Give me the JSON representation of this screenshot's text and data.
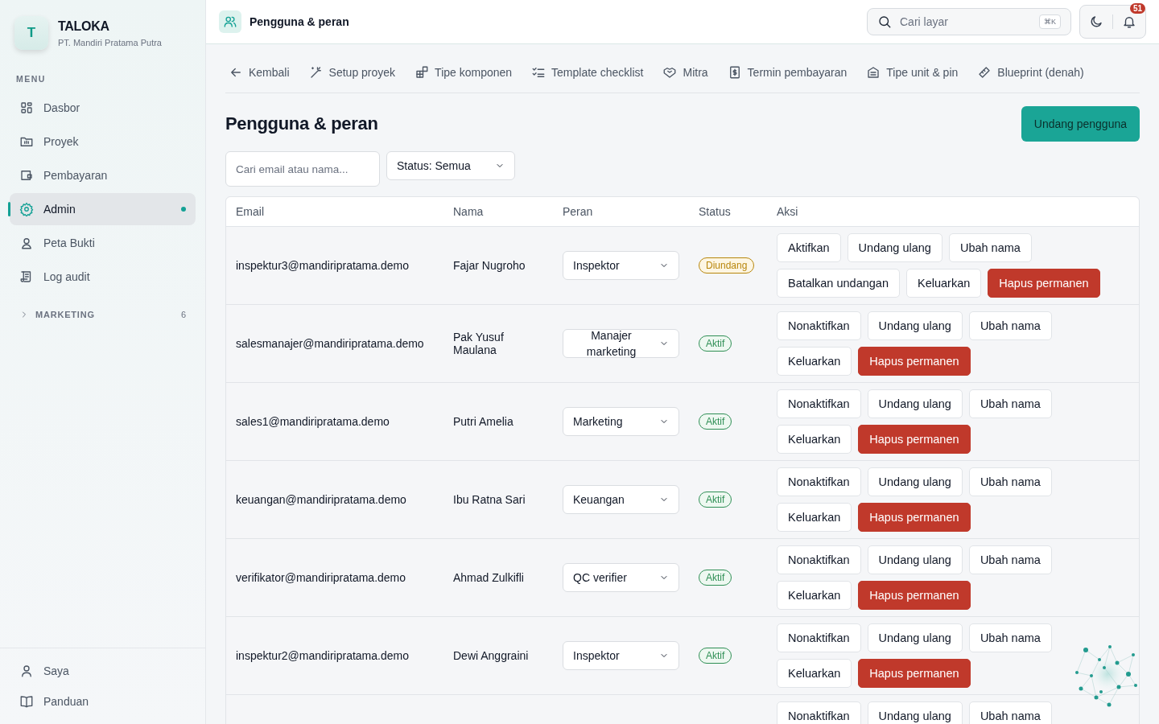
{
  "brand": {
    "logo_letter": "T",
    "name": "TALOKA",
    "company": "PT. Mandiri Pratama Putra"
  },
  "sidebar": {
    "section_label": "MENU",
    "items": [
      {
        "label": "Dasbor",
        "selected": false
      },
      {
        "label": "Proyek",
        "selected": false
      },
      {
        "label": "Pembayaran",
        "selected": false
      },
      {
        "label": "Admin",
        "selected": true
      },
      {
        "label": "Peta Bukti",
        "selected": false
      },
      {
        "label": "Log audit",
        "selected": false
      }
    ],
    "group": {
      "label": "MARKETING",
      "count": "6",
      "expanded": false
    },
    "footer_items": [
      {
        "label": "Saya"
      },
      {
        "label": "Panduan"
      }
    ]
  },
  "topbar": {
    "title": "Pengguna & peran",
    "search": {
      "placeholder": "Cari layar",
      "shortcut": "⌘K"
    },
    "notification_count": "51"
  },
  "subnav": [
    {
      "label": "Kembali"
    },
    {
      "label": "Setup proyek"
    },
    {
      "label": "Tipe komponen"
    },
    {
      "label": "Template checklist"
    },
    {
      "label": "Mitra"
    },
    {
      "label": "Termin pembayaran"
    },
    {
      "label": "Tipe unit & pin"
    },
    {
      "label": "Blueprint (denah)"
    }
  ],
  "page": {
    "title": "Pengguna & peran",
    "primary_button": "Undang pengguna"
  },
  "filters": {
    "search": {
      "placeholder": "Cari email atau nama..."
    },
    "status": {
      "value": "Status: Semua"
    }
  },
  "table": {
    "columns": [
      "Email",
      "Nama",
      "Peran",
      "Status",
      "Aksi"
    ],
    "rows": [
      {
        "email": "inspektur3@mandiripratama.demo",
        "name": "Fajar Nugroho",
        "role": "Inspektor",
        "status": {
          "label": "Diundang",
          "kind": "invited"
        },
        "actions": [
          {
            "label": "Aktifkan",
            "kind": "default"
          },
          {
            "label": "Undang ulang",
            "kind": "default"
          },
          {
            "label": "Ubah nama",
            "kind": "default"
          },
          {
            "label": "Batalkan undangan",
            "kind": "default"
          },
          {
            "label": "Keluarkan",
            "kind": "default"
          },
          {
            "label": "Hapus permanen",
            "kind": "danger"
          }
        ]
      },
      {
        "email": "salesmanajer@mandiripratama.demo",
        "name": "Pak Yusuf Maulana",
        "role": "Manajer marketing",
        "status": {
          "label": "Aktif",
          "kind": "active"
        },
        "actions": [
          {
            "label": "Nonaktifkan",
            "kind": "default"
          },
          {
            "label": "Undang ulang",
            "kind": "default"
          },
          {
            "label": "Ubah nama",
            "kind": "default"
          },
          {
            "label": "Keluarkan",
            "kind": "default"
          },
          {
            "label": "Hapus permanen",
            "kind": "danger"
          }
        ]
      },
      {
        "email": "sales1@mandiripratama.demo",
        "name": "Putri Amelia",
        "role": "Marketing",
        "status": {
          "label": "Aktif",
          "kind": "active"
        },
        "actions": [
          {
            "label": "Nonaktifkan",
            "kind": "default"
          },
          {
            "label": "Undang ulang",
            "kind": "default"
          },
          {
            "label": "Ubah nama",
            "kind": "default"
          },
          {
            "label": "Keluarkan",
            "kind": "default"
          },
          {
            "label": "Hapus permanen",
            "kind": "danger"
          }
        ]
      },
      {
        "email": "keuangan@mandiripratama.demo",
        "name": "Ibu Ratna Sari",
        "role": "Keuangan",
        "status": {
          "label": "Aktif",
          "kind": "active"
        },
        "actions": [
          {
            "label": "Nonaktifkan",
            "kind": "default"
          },
          {
            "label": "Undang ulang",
            "kind": "default"
          },
          {
            "label": "Ubah nama",
            "kind": "default"
          },
          {
            "label": "Keluarkan",
            "kind": "default"
          },
          {
            "label": "Hapus permanen",
            "kind": "danger"
          }
        ]
      },
      {
        "email": "verifikator@mandiripratama.demo",
        "name": "Ahmad Zulkifli",
        "role": "QC verifier",
        "status": {
          "label": "Aktif",
          "kind": "active"
        },
        "actions": [
          {
            "label": "Nonaktifkan",
            "kind": "default"
          },
          {
            "label": "Undang ulang",
            "kind": "default"
          },
          {
            "label": "Ubah nama",
            "kind": "default"
          },
          {
            "label": "Keluarkan",
            "kind": "default"
          },
          {
            "label": "Hapus permanen",
            "kind": "danger"
          }
        ]
      },
      {
        "email": "inspektur2@mandiripratama.demo",
        "name": "Dewi Anggraini",
        "role": "Inspektor",
        "status": {
          "label": "Aktif",
          "kind": "active"
        },
        "actions": [
          {
            "label": "Nonaktifkan",
            "kind": "default"
          },
          {
            "label": "Undang ulang",
            "kind": "default"
          },
          {
            "label": "Ubah nama",
            "kind": "default"
          },
          {
            "label": "Keluarkan",
            "kind": "default"
          },
          {
            "label": "Hapus permanen",
            "kind": "danger"
          }
        ]
      },
      {
        "actions": [
          {
            "label": "Nonaktifkan",
            "kind": "default"
          },
          {
            "label": "Undang ulang",
            "kind": "default"
          },
          {
            "label": "Ubah nama",
            "kind": "default"
          }
        ]
      }
    ]
  }
}
